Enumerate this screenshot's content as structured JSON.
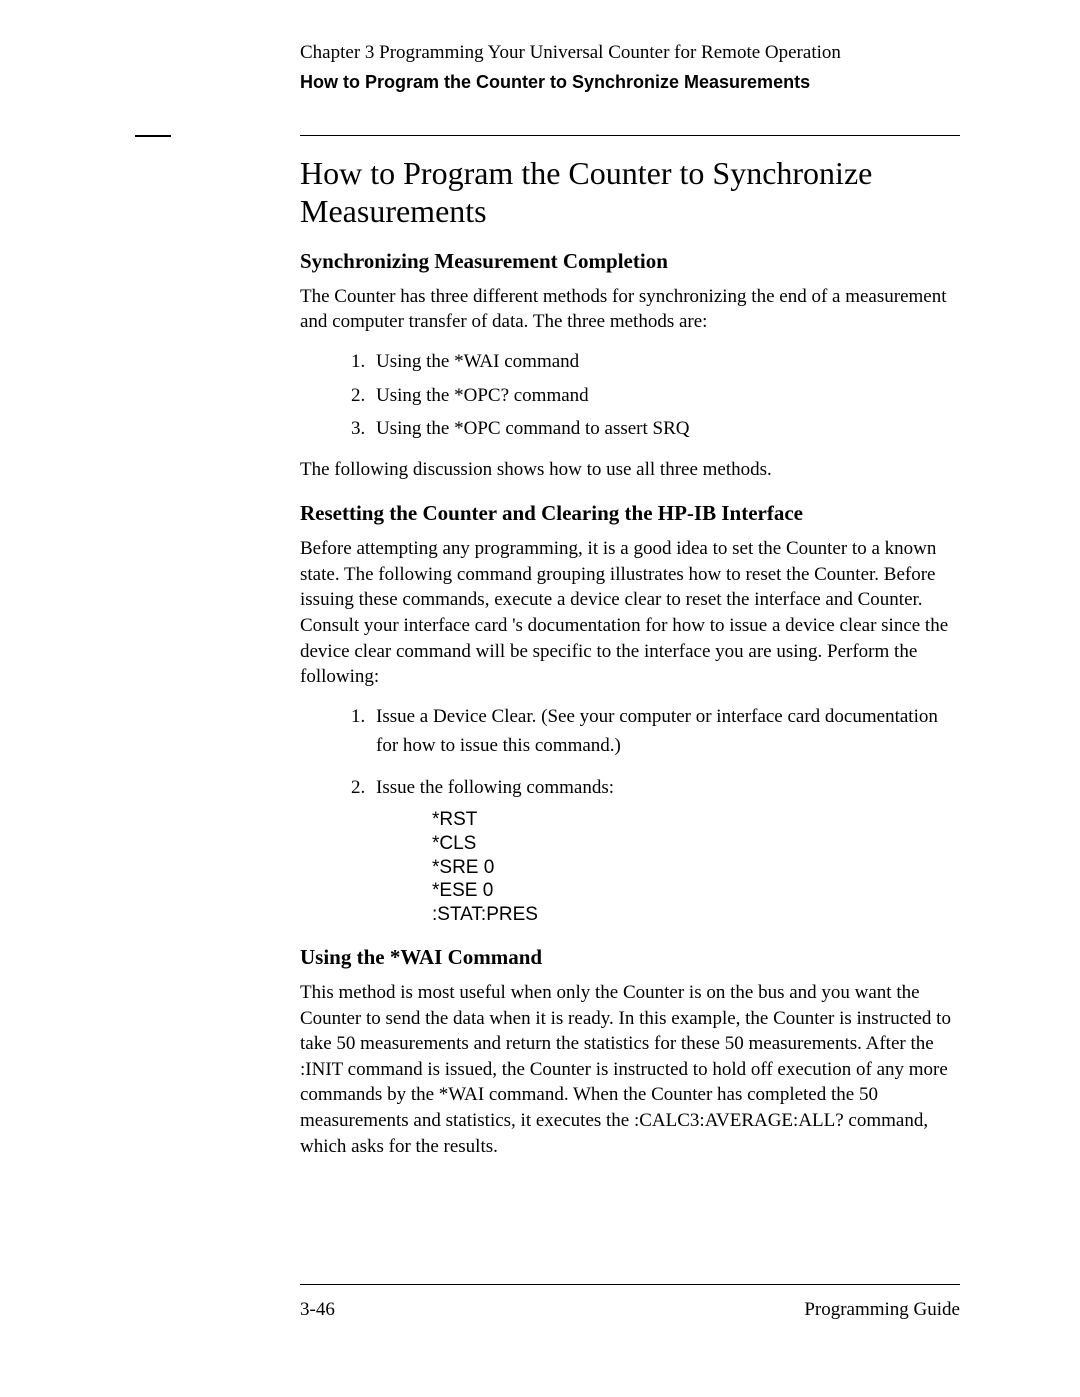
{
  "header": {
    "chapter": "Chapter 3   Programming Your Universal Counter for Remote Operation",
    "section": "How to Program the Counter to Synchronize Measurements"
  },
  "main_heading": "How to Program the Counter to Synchronize Measurements",
  "sec1": {
    "heading": "Synchronizing Measurement Completion",
    "para": "The Counter has three different methods for synchronizing the end of a measurement and computer transfer of data. The three methods are:",
    "methods": [
      "Using the *WAI command",
      "Using the *OPC? command",
      "Using the *OPC command to assert SRQ"
    ],
    "closing": "The following discussion shows how to use all three methods."
  },
  "sec2": {
    "heading": "Resetting the Counter and Clearing the HP-IB Interface",
    "para": "Before attempting any programming, it is a good idea to set the Counter to a known state. The following command grouping illustrates how to reset the Counter. Before issuing these commands, execute a device clear to reset the interface and Counter. Consult your interface card 's documentation for how to issue a device clear since the device clear command will be specific to the interface you are using. Perform the following:",
    "steps": [
      "Issue a Device Clear. (See your computer or interface card documentation for how to issue this command.)",
      "Issue the following commands:"
    ],
    "code": "*RST\n*CLS\n*SRE 0\n*ESE 0\n:STAT:PRES"
  },
  "sec3": {
    "heading": "Using the *WAI Command",
    "para": "This method is most useful when only the Counter is on the bus and you want the Counter to send the data when it is ready. In this example, the Counter is instructed to take 50 measurements and return the statistics for these 50 measurements. After the :INIT command is issued, the Counter is instructed to hold off execution of any more commands by the *WAI command. When the Counter has completed the 50 measurements and statistics, it executes the :CALC3:AVERAGE:ALL? command, which asks for the results."
  },
  "footer": {
    "page": "3-46",
    "title": "Programming Guide"
  }
}
